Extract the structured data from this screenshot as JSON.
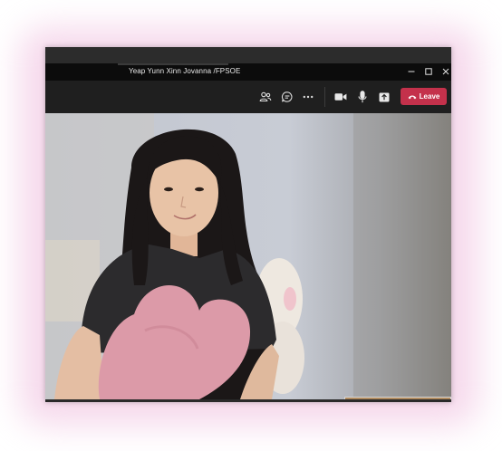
{
  "window": {
    "title": "Yeap Yunn Xinn Jovanna /FPSOE"
  },
  "window_controls": {
    "minimize_icon": "minimize-icon",
    "maximize_icon": "maximize-icon",
    "close_icon": "close-icon"
  },
  "toolbar": {
    "leave_label": "Leave",
    "icons": [
      "participants-icon",
      "chat-icon",
      "more-options-icon",
      "camera-icon",
      "microphone-icon",
      "share-screen-icon",
      "phone-hangup-icon"
    ]
  },
  "colors": {
    "leave_button": "#c4314b",
    "title_bar": "#0c0c0c",
    "toolbar": "#1f1f1f"
  }
}
